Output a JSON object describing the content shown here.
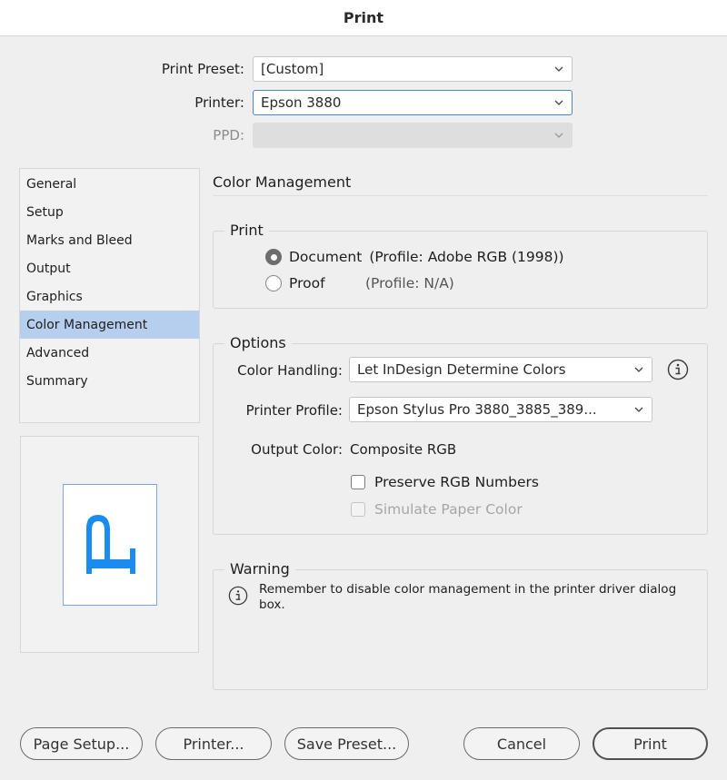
{
  "window": {
    "title": "Print"
  },
  "top_fields": {
    "print_preset": {
      "label": "Print Preset:",
      "value": "[Custom]"
    },
    "printer": {
      "label": "Printer:",
      "value": "Epson 3880"
    },
    "ppd": {
      "label": "PPD:",
      "value": ""
    }
  },
  "sidebar": {
    "items": [
      {
        "label": "General"
      },
      {
        "label": "Setup"
      },
      {
        "label": "Marks and Bleed"
      },
      {
        "label": "Output"
      },
      {
        "label": "Graphics"
      },
      {
        "label": "Color Management",
        "active": true
      },
      {
        "label": "Advanced"
      },
      {
        "label": "Summary"
      }
    ]
  },
  "preview": {
    "glyph": "P"
  },
  "main": {
    "title": "Color Management",
    "print_group": {
      "legend": "Print",
      "document": {
        "label": "Document",
        "profile": "(Profile: Adobe RGB (1998))",
        "checked": true
      },
      "proof": {
        "label": "Proof",
        "profile": "(Profile: N/A)",
        "checked": false
      }
    },
    "options_group": {
      "legend": "Options",
      "color_handling": {
        "label": "Color Handling:",
        "value": "Let InDesign Determine Colors"
      },
      "printer_profile": {
        "label": "Printer Profile:",
        "value": "Epson Stylus Pro 3880_3885_389..."
      },
      "output_color": {
        "label": "Output Color:",
        "value": "Composite RGB"
      },
      "preserve_rgb": {
        "label": "Preserve RGB Numbers",
        "checked": false
      },
      "simulate_paper": {
        "label": "Simulate Paper Color",
        "checked": false,
        "disabled": true
      }
    },
    "warning_group": {
      "legend": "Warning",
      "message": "Remember to disable color management in the printer driver dialog box."
    }
  },
  "buttons": {
    "page_setup": "Page Setup...",
    "printer": "Printer...",
    "save_preset": "Save Preset...",
    "cancel": "Cancel",
    "print": "Print"
  },
  "colors": {
    "selection": "#b6cfee",
    "focus_ring": "#4a86c8",
    "preview_glyph": "#1a8cf0",
    "preview_border": "#7ea6e4"
  }
}
